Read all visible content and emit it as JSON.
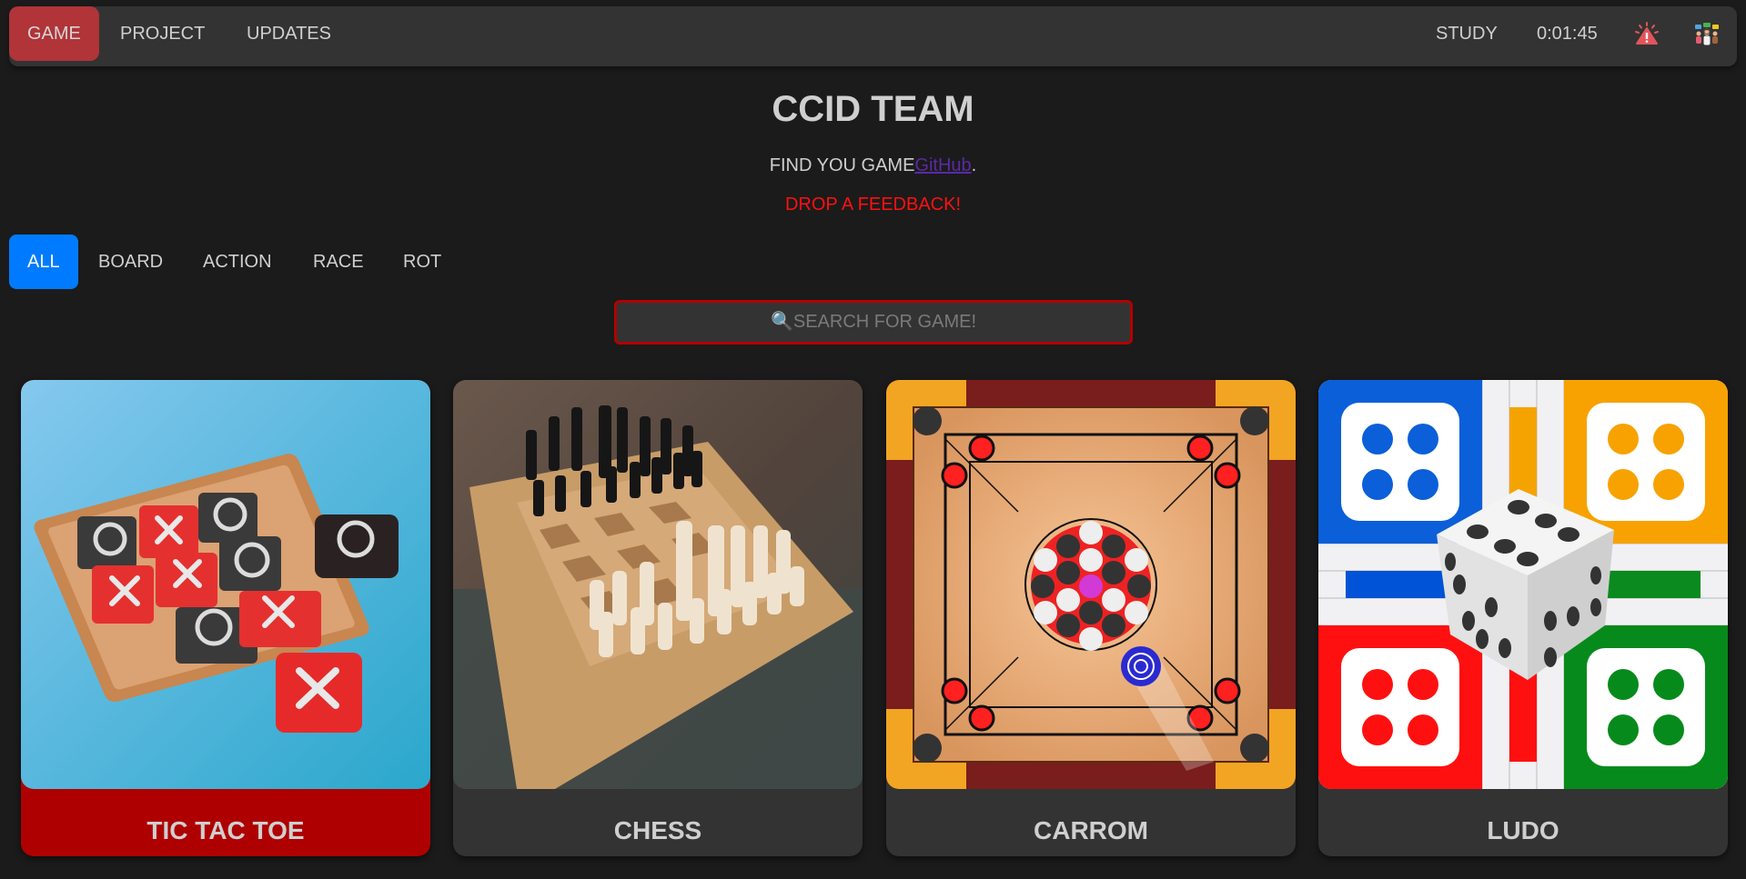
{
  "navbar": {
    "items": [
      {
        "label": "GAME",
        "active": true
      },
      {
        "label": "PROJECT",
        "active": false
      },
      {
        "label": "UPDATES",
        "active": false
      }
    ],
    "study_label": "STUDY",
    "timer": "0:01:45",
    "alert_icon": "alert-icon",
    "team_icon": "team-chat-icon",
    "accent_color": "#b03438"
  },
  "header": {
    "title": "CCID TEAM",
    "subtitle_text": "FIND YOU GAME",
    "subtitle_link": "GitHub",
    "subtitle_end": ".",
    "feedback": "DROP A FEEDBACK!"
  },
  "filters": [
    {
      "label": "ALL",
      "active": true
    },
    {
      "label": "BOARD",
      "active": false
    },
    {
      "label": "ACTION",
      "active": false
    },
    {
      "label": "RACE",
      "active": false
    },
    {
      "label": "ROT",
      "active": false
    }
  ],
  "search": {
    "placeholder": "🔍SEARCH FOR GAME!",
    "value": ""
  },
  "games": [
    {
      "name": "TIC TAC TOE",
      "image": "tic-tac-toe-board",
      "hovered": true
    },
    {
      "name": "CHESS",
      "image": "chess-board",
      "hovered": false
    },
    {
      "name": "CARROM",
      "image": "carrom-board",
      "hovered": false
    },
    {
      "name": "LUDO",
      "image": "ludo-board",
      "hovered": false
    }
  ],
  "colors": {
    "filter_active": "#007bff",
    "search_border": "#b30000",
    "card_hover": "#ae0000",
    "feedback": "#ff1010",
    "link": "#5b2aa3"
  }
}
